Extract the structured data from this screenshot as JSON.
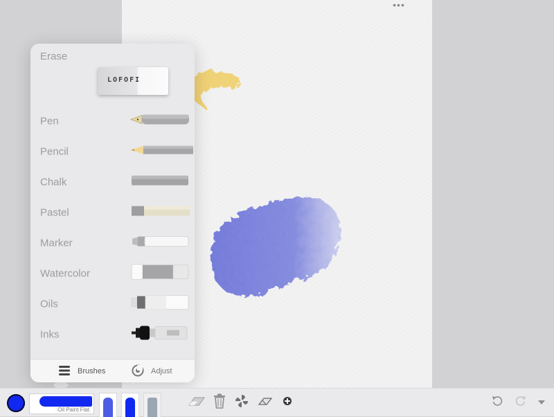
{
  "colors": {
    "accent": "#1128f0",
    "panel_background": "#e9e9eb",
    "label_gray": "#9c9ca0",
    "watercolor_stroke": "#6a72d8",
    "pastel_stroke": "#f0c850"
  },
  "canvas": {
    "menu_icon": "ellipsis-icon",
    "menu_glyph": "•••"
  },
  "brush_panel": {
    "erase_label": "Erase",
    "eraser_brand": "LOFOFI",
    "brushes": [
      {
        "label": "Pen",
        "icon": "fountain-pen-icon"
      },
      {
        "label": "Pencil",
        "icon": "pencil-icon"
      },
      {
        "label": "Chalk",
        "icon": "chalk-icon"
      },
      {
        "label": "Pastel",
        "icon": "pastel-icon"
      },
      {
        "label": "Marker",
        "icon": "marker-icon"
      },
      {
        "label": "Watercolor",
        "icon": "watercolor-tube-icon"
      },
      {
        "label": "Oils",
        "icon": "oil-tube-icon"
      },
      {
        "label": "Inks",
        "icon": "ink-dropper-icon"
      }
    ],
    "footer": {
      "brushes_label": "Brushes",
      "adjust_label": "Adjust"
    }
  },
  "toolbar": {
    "current_color": "#1128f0",
    "current_brush_name": "Oil Paint Flat",
    "recent_brushes": [
      {
        "icon": "recent-watercolor-brush-icon",
        "color": "#2b3fe0"
      },
      {
        "icon": "recent-oil-brush-icon",
        "color": "#1128f0"
      },
      {
        "icon": "recent-gray-brush-icon",
        "color": "#9aa6b2"
      }
    ],
    "tools": [
      "eraser-tool-icon",
      "trash-icon",
      "fan-brush-icon",
      "eraser-small-icon",
      "add-icon"
    ],
    "undo_icon": "undo-icon",
    "redo_icon": "redo-icon",
    "more_icon": "chevron-down-icon"
  }
}
